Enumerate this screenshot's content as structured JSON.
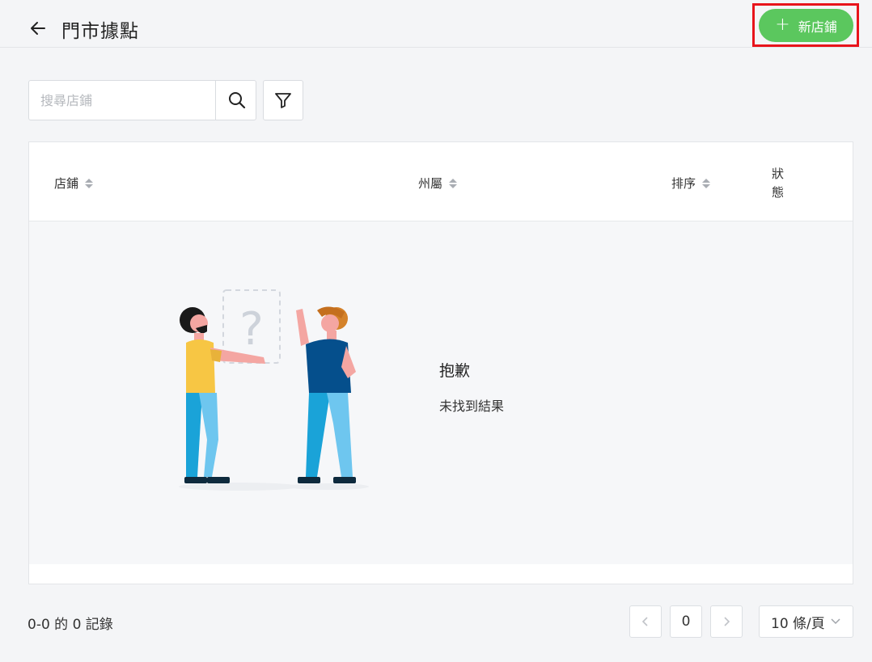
{
  "header": {
    "title": "門市據點",
    "new_store_label": "新店鋪",
    "accent_color": "#5bc75e"
  },
  "search": {
    "placeholder": "搜尋店鋪"
  },
  "table": {
    "columns": [
      "店鋪",
      "州屬",
      "排序",
      "狀態"
    ],
    "empty": {
      "title": "抱歉",
      "subtitle": "未找到結果"
    }
  },
  "footer": {
    "record_count": "0-0 的 0 記錄",
    "current_page": "0",
    "per_page": "10 條/頁"
  }
}
